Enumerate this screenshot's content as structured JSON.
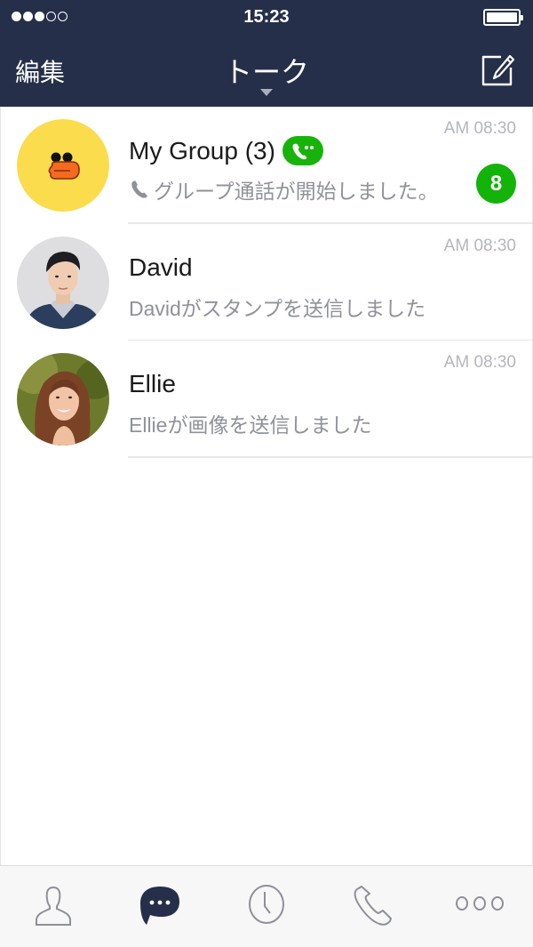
{
  "status_bar": {
    "signal_filled": 3,
    "signal_total": 5,
    "time": "15:23",
    "battery_level": 1.0
  },
  "nav": {
    "edit_label": "編集",
    "title": "トーク",
    "title_dropdown_icon": "caret-down-icon",
    "compose_icon": "compose-icon"
  },
  "chats": [
    {
      "name": "My Group (3)",
      "avatar": "duck-sticker-avatar",
      "has_group_call": true,
      "preview_icon": "phone-icon",
      "preview": "グループ通話が開始しました。",
      "time": "AM 08:30",
      "unread": "8"
    },
    {
      "name": "David",
      "avatar": "photo-avatar-david",
      "has_group_call": false,
      "preview": "Davidがスタンプを送信しました",
      "time": "AM 08:30"
    },
    {
      "name": "Ellie",
      "avatar": "photo-avatar-ellie",
      "has_group_call": false,
      "preview": "Ellieが画像を送信しました",
      "time": "AM 08:30"
    }
  ],
  "tabbar": {
    "items": [
      {
        "icon": "friends-icon",
        "active": false
      },
      {
        "icon": "chats-icon",
        "active": true
      },
      {
        "icon": "timeline-icon",
        "active": false
      },
      {
        "icon": "calls-icon",
        "active": false
      },
      {
        "icon": "more-icon",
        "active": false
      }
    ]
  },
  "colors": {
    "header_bg": "#252f49",
    "accent_green": "#13b30a",
    "active_tab": "#252f49",
    "inactive_tab": "#8e9098",
    "preview_text": "#8f929a",
    "time_text": "#b3b6bc"
  }
}
